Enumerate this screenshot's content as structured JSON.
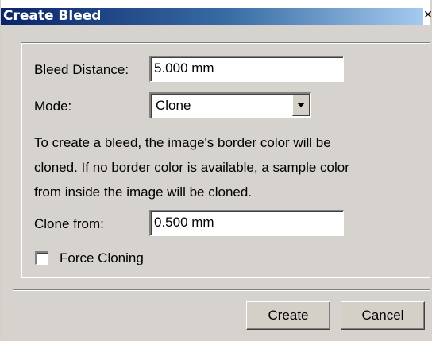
{
  "window": {
    "title": "Create Bleed",
    "close_glyph": "✕"
  },
  "form": {
    "bleed_distance_label": "Bleed Distance:",
    "bleed_distance_value": "5.000 mm",
    "mode_label": "Mode:",
    "mode_value": "Clone",
    "description_lines": [
      "To create a bleed, the image's border color will be",
      "cloned. If no border color is available, a sample color",
      "from inside the image will be cloned."
    ],
    "clone_from_label": "Clone from:",
    "clone_from_value": "0.500 mm",
    "force_cloning_label": "Force Cloning",
    "force_cloning_checked": false
  },
  "buttons": {
    "create": "Create",
    "cancel": "Cancel"
  },
  "icons": {
    "close": "close-icon",
    "dropdown": "chevron-down-icon"
  },
  "colors": {
    "title_gradient_start": "#0a246a",
    "title_gradient_end": "#a6caf0",
    "dialog_face": "#d6d3ce"
  }
}
